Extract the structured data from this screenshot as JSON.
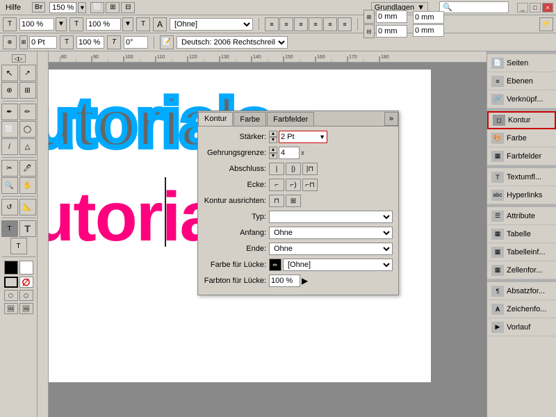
{
  "menubar": {
    "items": [
      "Hilfe"
    ],
    "zoom_label": "150 %",
    "workspace_label": "Grundlagen",
    "search_placeholder": ""
  },
  "toolbar1": {
    "font_size1": "100 %",
    "font_size2": "100 %",
    "font_name": "[Ohne]",
    "language": "Deutsch: 2006 Rechtschreib.",
    "offset_right1": "0 mm",
    "offset_right2": "0 mm",
    "offset_right3": "0 mm",
    "offset_right4": "0 mm"
  },
  "kontur_panel": {
    "tab_kontur": "Kontur",
    "tab_farbe": "Farbe",
    "tab_farbfelder": "Farbfelder",
    "starker_label": "Stärker:",
    "starker_value": "2 Pt",
    "gehrung_label": "Gehrungsgrenze:",
    "gehrung_value": "4",
    "x_label": "x",
    "abschluss_label": "Abschluss:",
    "ecke_label": "Ecke:",
    "kontur_ausrichten_label": "Kontur ausrichten:",
    "typ_label": "Typ:",
    "anfang_label": "Anfang:",
    "anfang_value": "Ohne",
    "ende_label": "Ende:",
    "ende_value": "Ohne",
    "farbe_label": "Farbe für Lücke:",
    "farbe_value": "[Ohne]",
    "farbton_label": "Farbton für Lücke:",
    "farbton_value": "100 %"
  },
  "right_panel": {
    "items": [
      {
        "id": "seiten",
        "label": "Seiten",
        "icon": "📄"
      },
      {
        "id": "ebenen",
        "label": "Ebenen",
        "icon": "📋"
      },
      {
        "id": "verknupf",
        "label": "Verknüpf...",
        "icon": "🔗"
      },
      {
        "id": "kontur",
        "label": "Kontur",
        "icon": "◻"
      },
      {
        "id": "farbe",
        "label": "Farbe",
        "icon": "🎨"
      },
      {
        "id": "farbfelder",
        "label": "Farbfelder",
        "icon": "▦"
      },
      {
        "id": "textumfl",
        "label": "Textumfl...",
        "icon": "T"
      },
      {
        "id": "hyperlinks",
        "label": "Hyperlinks",
        "icon": "🔗"
      },
      {
        "id": "attribute",
        "label": "Attribute",
        "icon": "☰"
      },
      {
        "id": "tabelle",
        "label": "Tabelle",
        "icon": "▦"
      },
      {
        "id": "tabelleinf",
        "label": "Tabelleinf...",
        "icon": "▦"
      },
      {
        "id": "zellenfor",
        "label": "Zellenfor...",
        "icon": "▦"
      },
      {
        "id": "absatzfor",
        "label": "Absatzfor...",
        "icon": "¶"
      },
      {
        "id": "zeichenfo",
        "label": "Zeichenfo...",
        "icon": "A"
      },
      {
        "id": "vorlauf",
        "label": "Vorlauf",
        "icon": "▶"
      }
    ]
  },
  "canvas": {
    "text_tutorials": "tutorials.",
    "text_tutorials_de": "tutorials.de",
    "ruler_start": 80,
    "ruler_end": 180,
    "ruler_step": 10
  },
  "toolbox": {
    "tools": [
      "↖",
      "↗",
      "⊕",
      "⊞",
      "✂",
      "✒",
      "🖊",
      "⬜",
      "◯",
      "△",
      "🖊",
      "✏",
      "🔍",
      "🤚",
      "🔄",
      "📐",
      "T",
      "T",
      "T",
      "⬛",
      "⬜",
      "🔲",
      "⬡",
      "⬡",
      "🖼",
      "🖼"
    ]
  }
}
